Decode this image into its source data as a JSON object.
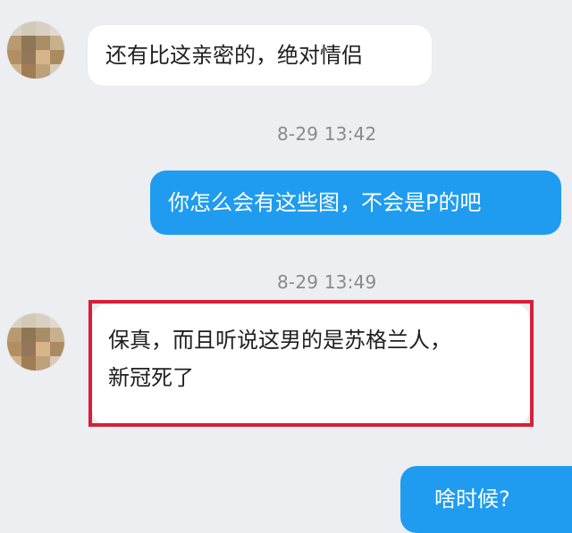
{
  "messages": [
    {
      "side": "incoming",
      "text": "还有比这亲密的，绝对情侣"
    },
    {
      "side": "outgoing",
      "text": "你怎么会有这些图，不会是P的吧"
    },
    {
      "side": "incoming",
      "text_line1": "保真，而且听说这男的是苏格兰人，",
      "text_line2": "新冠死了"
    },
    {
      "side": "outgoing",
      "text": "啥时候?"
    }
  ],
  "timestamps": [
    "8-29 13:42",
    "8-29 13:49"
  ],
  "colors": {
    "background": "#eceef2",
    "incoming_bubble": "#ffffff",
    "outgoing_bubble": "#1f9cf0",
    "highlight_border": "#d61f3a",
    "timestamp_text": "#8a8a8a"
  },
  "avatar": {
    "name": "avatar-pixelated"
  }
}
